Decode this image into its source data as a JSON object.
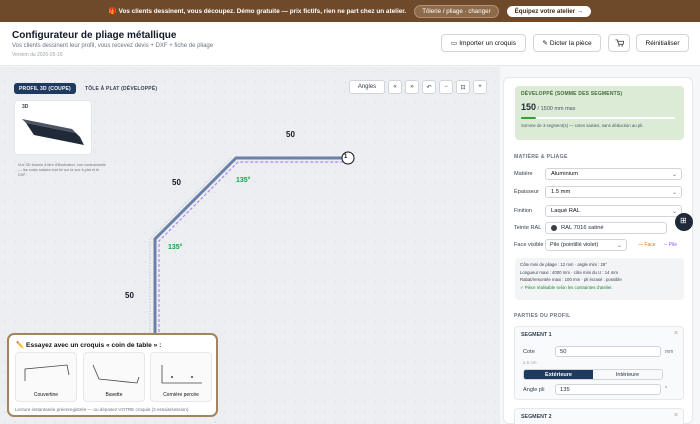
{
  "banner": {
    "icon": "gift-icon",
    "text": "🎁 Vos clients dessinent, vous découpez.  Démo gratuite — prix fictifs, rien ne part chez un atelier.",
    "mode_button": "Tôlerie / pliage · changer",
    "equip_button": "Équipez votre atelier →"
  },
  "header": {
    "title": "Configurateur de pliage métallique",
    "subtitle": "Vos clients dessinent leur profil, vous recevez devis + DXF + fiche de pliage",
    "version": "Version du 2026-05-16",
    "import_button": "Importer un croquis",
    "dictate_button": "Dicter la pièce",
    "cart_icon": "cart-icon",
    "reset_button": "Réinitialiser"
  },
  "canvas": {
    "tabs": [
      "PROFIL 3D (COUPE)",
      "TÔLE À PLAT (DÉVELOPPÉ)"
    ],
    "thumb_label": "3D",
    "thumb_note": "Vue 3D fournie à titre d'illustration, non contractuelle — les cotes saisies font foi sur la vue à plat et le DXF.",
    "toolbar": [
      "Angles",
      "«",
      "»",
      "↶",
      "−",
      "⊡",
      "+"
    ],
    "segment_labels": [
      "50",
      "50",
      "50"
    ],
    "angle_labels": [
      "135°",
      "135°"
    ],
    "start_marker": "1"
  },
  "sketch": {
    "title": "✏️ Essayez avec un croquis « coin de table » :",
    "cards": [
      "Couvertine",
      "Bavette",
      "Cornière percée"
    ],
    "footer": "Lecture instantanée préenregistrée — ou déposez VOTRE croquis (3 essais/session)"
  },
  "developed": {
    "title": "DÉVELOPPÉ (SOMME DES SEGMENTS)",
    "value": "150",
    "max": " / 1500 mm max",
    "fraction": 0.1,
    "note": "Somme de 3 segment(s) — cotes saisies, sans déduction au pli."
  },
  "material": {
    "section_title": "MATIÈRE & PLIAGE",
    "rows": [
      {
        "label": "Matière",
        "value": "Aluminium"
      },
      {
        "label": "Épaisseur",
        "value": "1.5 mm"
      },
      {
        "label": "Finition",
        "value": "Laqué RAL"
      }
    ],
    "ral_label": "Teinte RAL",
    "ral_value": "RAL 7016 satiné",
    "ral_color": "#3a3f44",
    "face_label": "Face visible",
    "face_value": "Pile (pointillé violet)",
    "face_legend": "— Face",
    "pile_legend": "-- Pile",
    "info_lines": [
      "Côte mini de pliage : 12 mm · angle mini : 25°",
      "Longueur maxi : 4000 mm · côte mini du U : 14 mm",
      "Rabat/remontée maxi : 100 mm · pli écrasé : possible",
      "✓ Pièce réalisable selon les contraintes d'atelier."
    ]
  },
  "parts": {
    "section_title": "PARTIES DU PROFIL",
    "segment1": {
      "title": "SEGMENT 1",
      "cote_label": "Cote",
      "cote_value": "50",
      "unit": "mm",
      "min_note": "≥ 5 cm",
      "toggle": [
        "Extérieure",
        "Intérieure"
      ],
      "angle_label": "Angle pli",
      "angle_value": "135",
      "angle_unit": "°"
    },
    "segment2": {
      "title": "SEGMENT 2"
    }
  },
  "colors": {
    "banner": "#6e4a2a",
    "accent": "#1e3a5f",
    "profile": "#6b7fa8",
    "pile": "#a78bfa",
    "angle": "#16a34a"
  }
}
